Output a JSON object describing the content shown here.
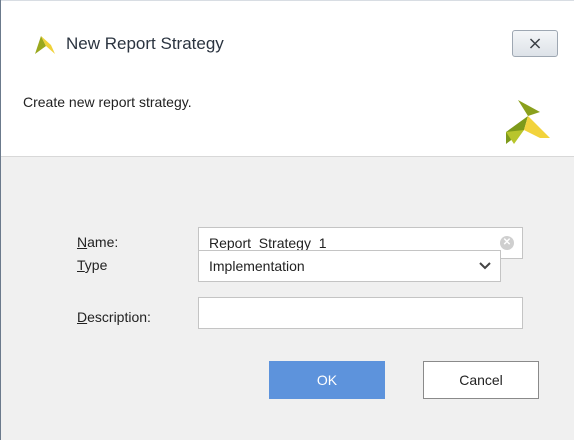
{
  "window": {
    "title": "New Report Strategy",
    "close_label": "⨯",
    "icon": "xilinx-logo-icon"
  },
  "header": {
    "description": "Create new report strategy.",
    "logo": "xilinx-logo-icon"
  },
  "form": {
    "name": {
      "label_mnemonic": "N",
      "label_rest": "ame:",
      "value": "Report_Strategy_1"
    },
    "type": {
      "label_mnemonic": "T",
      "label_rest": "ype",
      "value": "Implementation"
    },
    "description": {
      "label_mnemonic": "D",
      "label_rest": "escription:",
      "value": ""
    }
  },
  "buttons": {
    "ok": "OK",
    "cancel": "Cancel"
  },
  "colors": {
    "ok_button": "#5d93dc",
    "logo_green": "#8aa01c",
    "logo_yellow": "#f2d33c"
  }
}
